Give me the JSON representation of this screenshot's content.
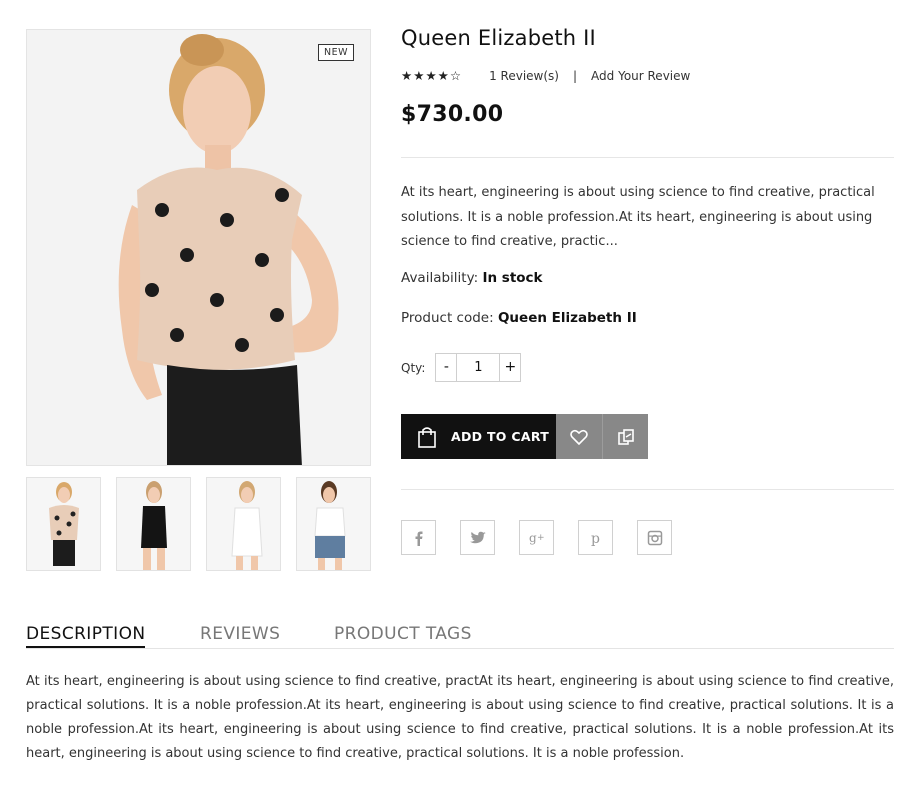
{
  "product": {
    "badge": "NEW",
    "title": "Queen Elizabeth II",
    "rating_value": 4,
    "rating_max": 5,
    "reviews_link": "1 Review(s)",
    "separator": "|",
    "add_review_link": "Add Your Review",
    "price": "$730.00",
    "short_description": "At its heart, engineering is about using science to find creative, practical solutions. It is a noble profession.At its heart, engineering is about using science to find creative, practic...",
    "availability_label": "Availability:",
    "availability_value": "In stock",
    "code_label": "Product code:",
    "code_value": "Queen Elizabeth II",
    "qty_label": "Qty:",
    "qty_minus": "-",
    "qty_value": "1",
    "qty_plus": "+",
    "add_to_cart": "ADD TO CART"
  },
  "icons": {
    "bag": "shopping-bag-icon",
    "wishlist": "heart-icon",
    "compare": "compare-icon",
    "social": [
      "facebook-icon",
      "twitter-icon",
      "google-plus-icon",
      "pinterest-icon",
      "instagram-icon"
    ]
  },
  "tabs": {
    "description": "DESCRIPTION",
    "reviews": "REVIEWS",
    "tags": "PRODUCT TAGS"
  },
  "long_description": "At its heart, engineering is about using science to find creative, practAt its heart, engineering is about using science to find creative, practical solutions. It is a noble profession.At its heart, engineering is about using science to find creative, practical solutions. It is a noble profession.At its heart, engineering is about using science to find creative, practical solutions. It is a noble profession.At its heart, engineering is about using science to find creative, practical solutions. It is a noble profession.",
  "colors": {
    "primary_button": "#111111",
    "secondary_button": "#888888",
    "star": "#222222"
  }
}
